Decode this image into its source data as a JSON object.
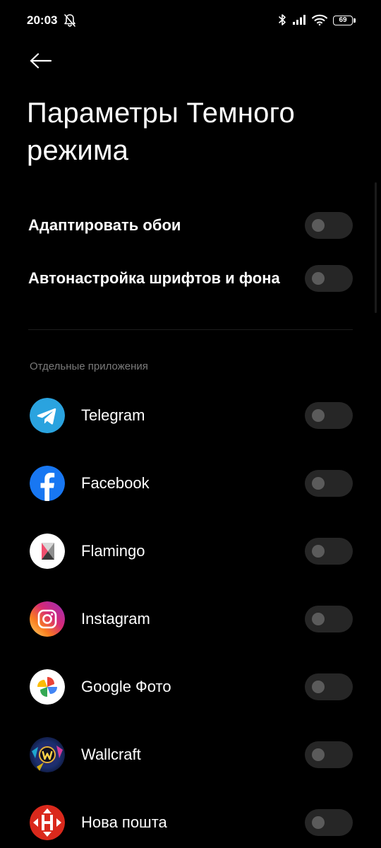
{
  "status_bar": {
    "time": "20:03",
    "battery": "69",
    "icons": [
      "bell-off-icon",
      "bluetooth-icon",
      "signal-icon",
      "wifi-icon",
      "battery-icon"
    ]
  },
  "header": {
    "back_icon": "arrow-left-icon",
    "title": "Параметры Темного режима"
  },
  "settings": [
    {
      "label": "Адаптировать обои",
      "enabled": false
    },
    {
      "label": "Автонастройка шрифтов и фона",
      "enabled": false
    }
  ],
  "section": {
    "title": "Отдельные приложения"
  },
  "apps": [
    {
      "name": "Telegram",
      "icon": "telegram-icon",
      "enabled": false
    },
    {
      "name": "Facebook",
      "icon": "facebook-icon",
      "enabled": false
    },
    {
      "name": "Flamingo",
      "icon": "flamingo-icon",
      "enabled": false
    },
    {
      "name": "Instagram",
      "icon": "instagram-icon",
      "enabled": false
    },
    {
      "name": "Google Фото",
      "icon": "google-photos-icon",
      "enabled": false
    },
    {
      "name": "Wallcraft",
      "icon": "wallcraft-icon",
      "enabled": false
    },
    {
      "name": "Нова пошта",
      "icon": "nova-poshta-icon",
      "enabled": false
    }
  ],
  "colors": {
    "background": "#000000",
    "switch_track": "#262626",
    "switch_knob": "#5b5b5b",
    "section_text": "#7a7a7a",
    "telegram": "#2aa3df",
    "facebook": "#1877f2",
    "nova_poshta": "#da291c"
  }
}
